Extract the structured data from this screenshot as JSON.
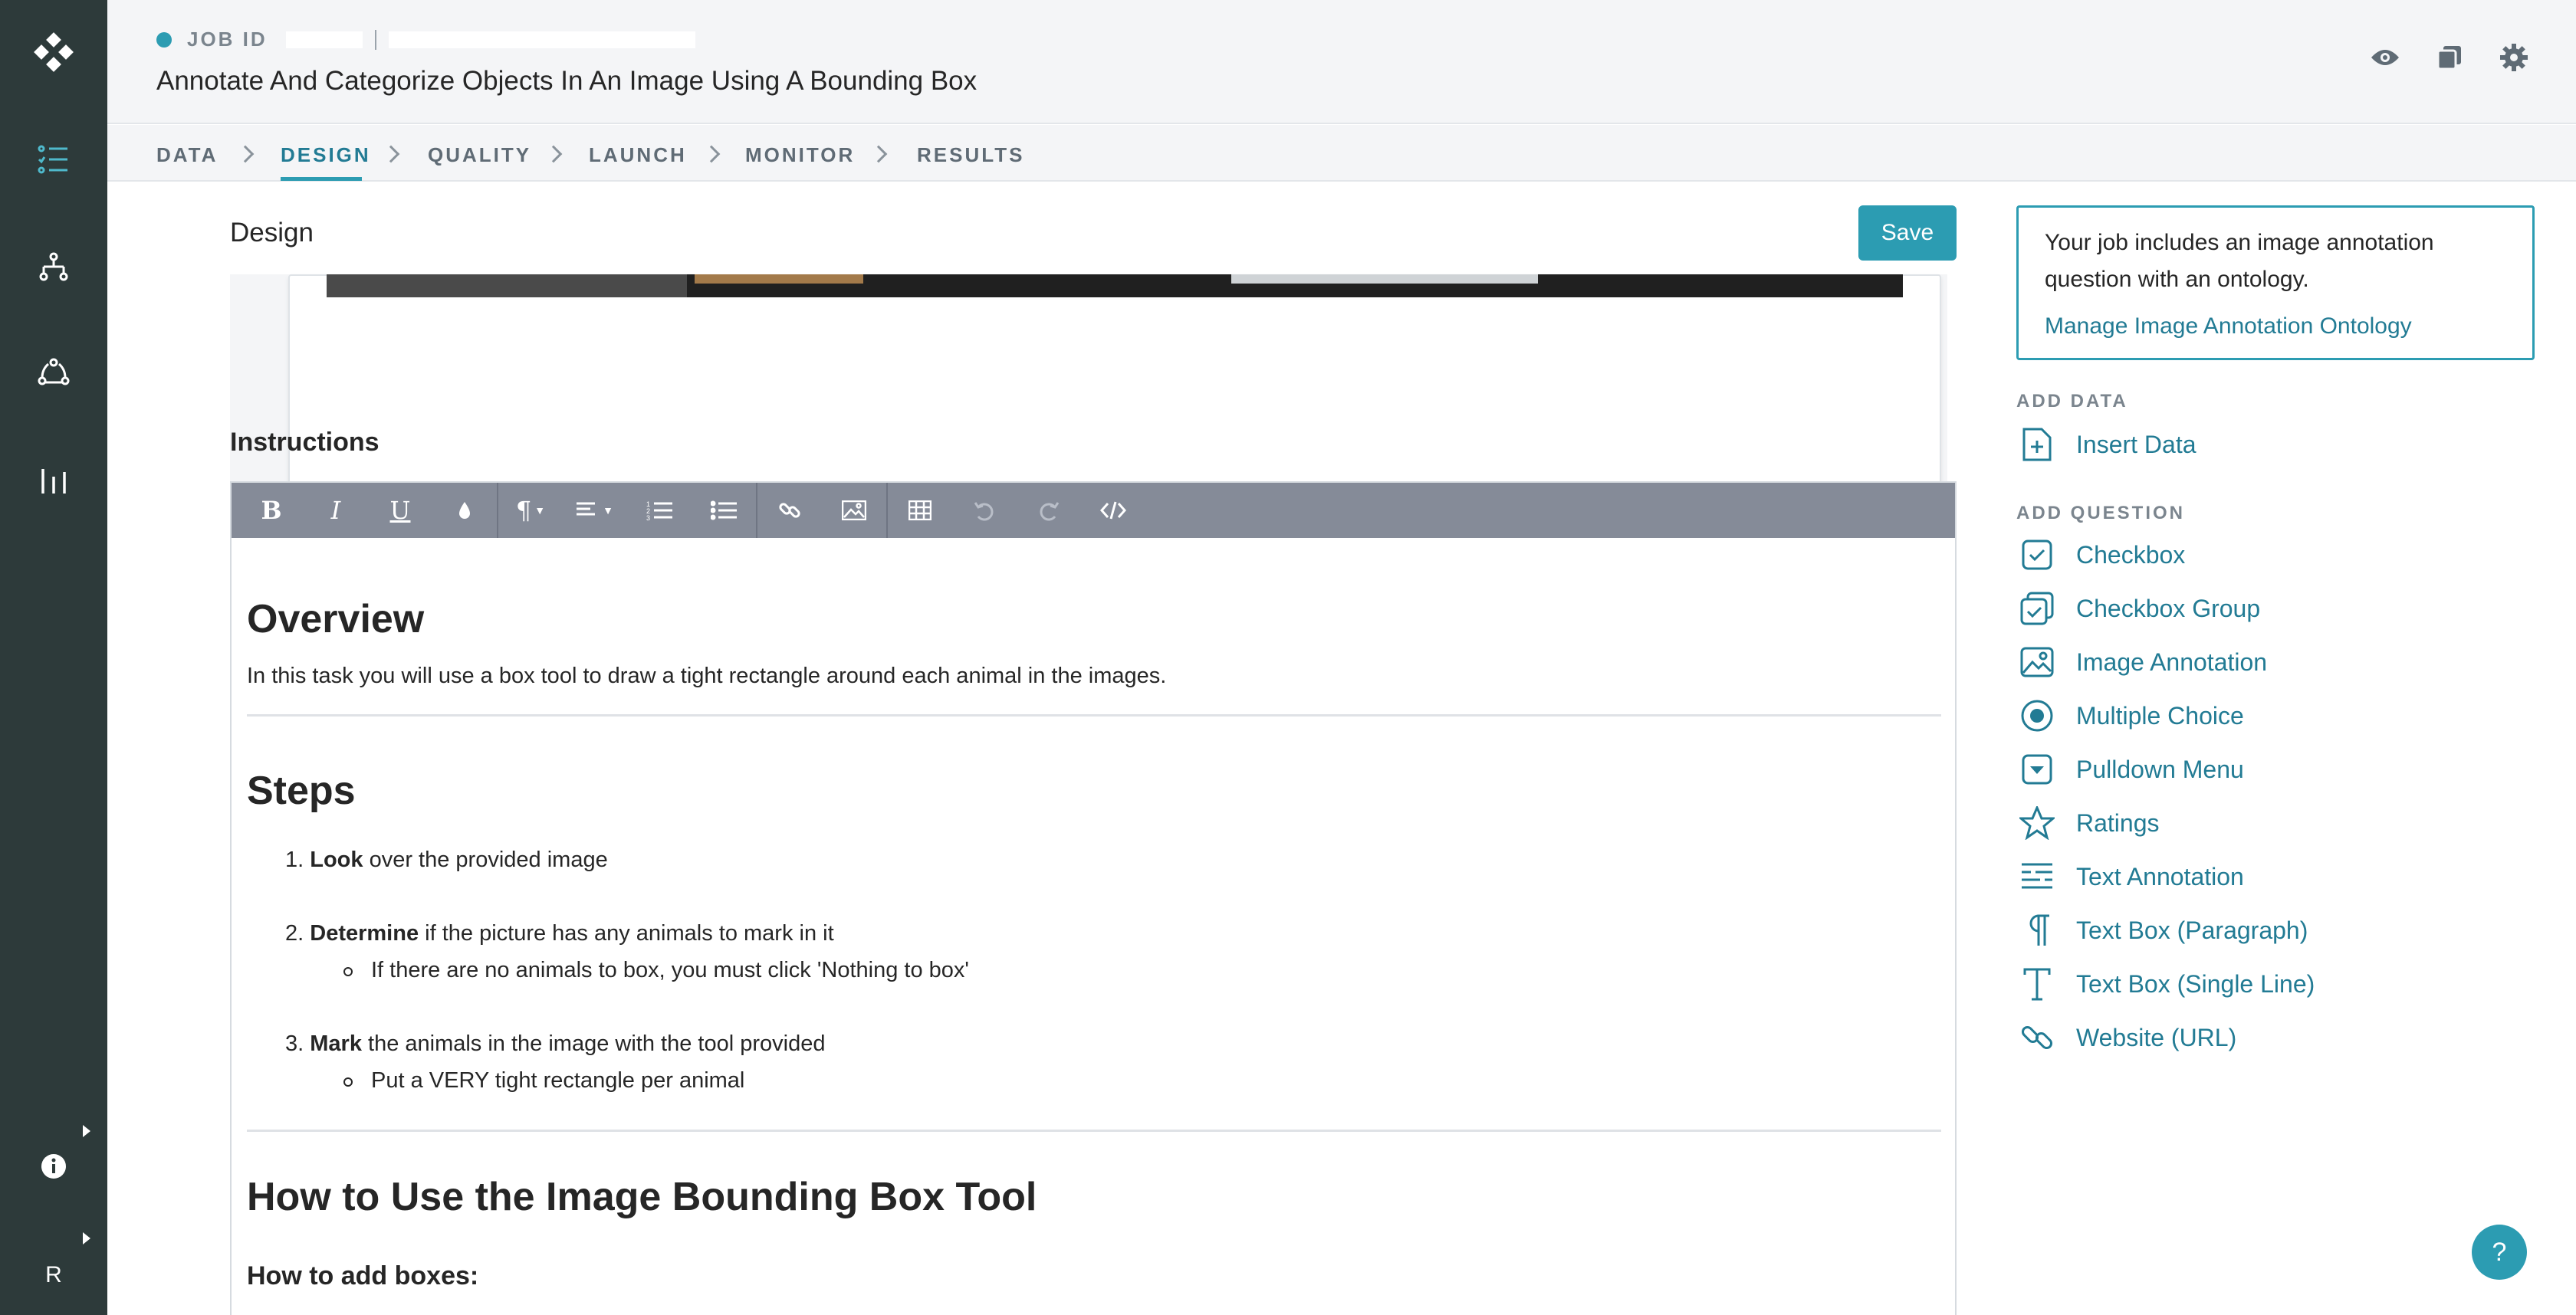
{
  "header": {
    "job_id_label": "JOB ID",
    "job_title": "Annotate And Categorize Objects In An Image Using A Bounding Box",
    "status_color": "#2c9cb2"
  },
  "steps": [
    {
      "label": "DATA"
    },
    {
      "label": "DESIGN",
      "active": true
    },
    {
      "label": "QUALITY"
    },
    {
      "label": "LAUNCH"
    },
    {
      "label": "MONITOR"
    },
    {
      "label": "RESULTS"
    }
  ],
  "main": {
    "design_title": "Design",
    "save_label": "Save",
    "instructions_title": "Instructions"
  },
  "editor": {
    "toolbar": [
      "bold-icon",
      "italic-icon",
      "underline-icon",
      "text-color-icon",
      "paragraph-icon",
      "align-icon",
      "ordered-list-icon",
      "unordered-list-icon",
      "link-icon",
      "image-icon",
      "table-icon",
      "undo-icon",
      "redo-icon",
      "code-icon"
    ],
    "overview_heading": "Overview",
    "overview_text": "In this task you will use a box tool to draw a tight rectangle around each animal in the images.",
    "steps_heading": "Steps",
    "steps": [
      {
        "num": "1.",
        "bold": "Look",
        "text": " over the provided image"
      },
      {
        "num": "2.",
        "bold": "Determine",
        "text": " if the picture has any animals to mark in it",
        "sub": "If there are no animals to box, you must click 'Nothing to box'"
      },
      {
        "num": "3.",
        "bold": "Mark",
        "text": " the animals in the image with the tool provided",
        "sub": "Put a VERY tight rectangle per animal"
      }
    ],
    "tool_heading": "How to Use the Image Bounding Box Tool",
    "add_boxes_heading": "How to add boxes:"
  },
  "right_panel": {
    "ontology_text": "Your job includes an image annotation question with an ontology.",
    "ontology_link": "Manage Image Annotation Ontology",
    "add_data_label": "ADD DATA",
    "insert_data": "Insert Data",
    "add_question_label": "ADD QUESTION",
    "questions": [
      {
        "label": "Checkbox",
        "icon": "checkbox-icon"
      },
      {
        "label": "Checkbox Group",
        "icon": "checkbox-group-icon"
      },
      {
        "label": "Image Annotation",
        "icon": "image-annotation-icon"
      },
      {
        "label": "Multiple Choice",
        "icon": "radio-icon"
      },
      {
        "label": "Pulldown Menu",
        "icon": "pulldown-icon"
      },
      {
        "label": "Ratings",
        "icon": "star-icon"
      },
      {
        "label": "Text Annotation",
        "icon": "text-annotation-icon"
      },
      {
        "label": "Text Box (Paragraph)",
        "icon": "paragraph-icon"
      },
      {
        "label": "Text Box (Single Line)",
        "icon": "text-icon"
      },
      {
        "label": "Website (URL)",
        "icon": "link-icon"
      }
    ]
  },
  "rail": {
    "user_initial": "R"
  },
  "help": {
    "label": "?"
  },
  "colors": {
    "accent": "#2c9cb2",
    "accent_dark": "#227b94",
    "rail": "#2d3a3a",
    "toolbar": "#858b98"
  }
}
